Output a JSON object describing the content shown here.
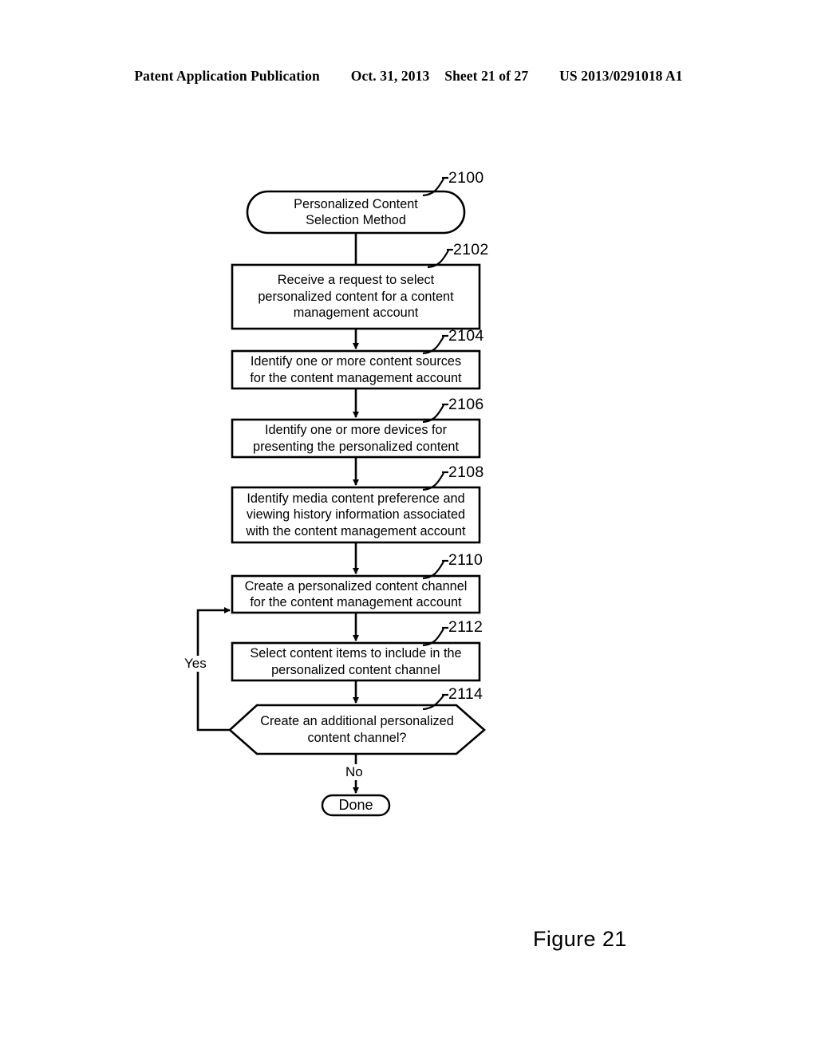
{
  "header": {
    "publication": "Patent Application Publication",
    "date": "Oct. 31, 2013",
    "sheet": "Sheet 21 of 27",
    "patent_number": "US 2013/0291018 A1"
  },
  "figure": {
    "caption": "Figure 21"
  },
  "flowchart": {
    "nodes": [
      {
        "ref": "2100",
        "shape": "terminal",
        "text": "Personalized Content\nSelection Method"
      },
      {
        "ref": "2102",
        "shape": "process",
        "text": "Receive a request to select\npersonalized content for a content\nmanagement account"
      },
      {
        "ref": "2104",
        "shape": "process",
        "text": "Identify one or more content sources\nfor the content management account"
      },
      {
        "ref": "2106",
        "shape": "process",
        "text": "Identify one or more devices for\npresenting the personalized content"
      },
      {
        "ref": "2108",
        "shape": "process",
        "text": "Identify media content preference and\nviewing history information associated\nwith the content management account"
      },
      {
        "ref": "2110",
        "shape": "process",
        "text": "Create a personalized content channel\nfor the content management account"
      },
      {
        "ref": "2112",
        "shape": "process",
        "text": "Select content items to include in the\npersonalized content channel"
      },
      {
        "ref": "2114",
        "shape": "decision-hexagon",
        "text": "Create an additional personalized\ncontent channel?"
      },
      {
        "ref": "",
        "shape": "terminal",
        "text": "Done"
      }
    ],
    "edge_labels": {
      "yes": "Yes",
      "no": "No"
    },
    "colors": {
      "stroke": "#000000",
      "fill": "#ffffff"
    }
  }
}
